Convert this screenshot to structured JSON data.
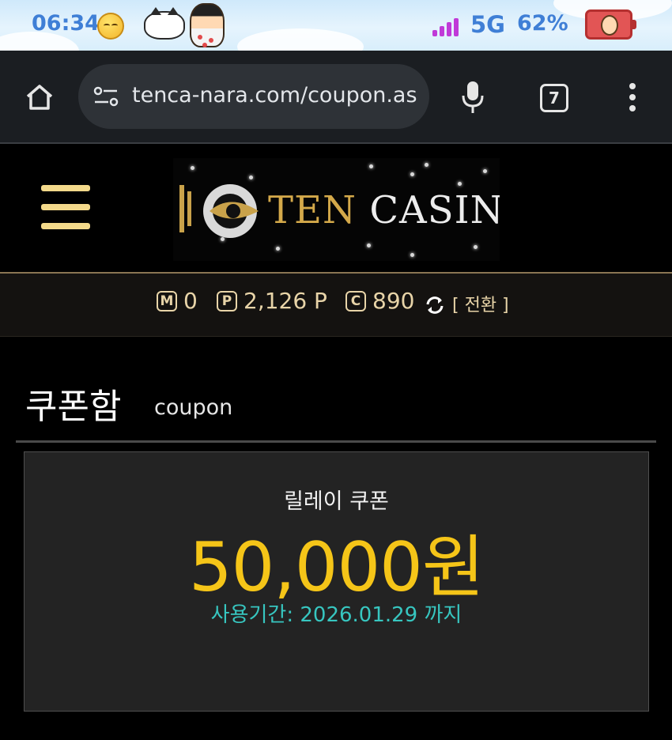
{
  "status_bar": {
    "time": "06:34",
    "network": "5G",
    "battery": "62%"
  },
  "browser": {
    "url": "tenca-nara.com/coupon.as",
    "tab_count": "7"
  },
  "site": {
    "logo_word_1": "TEN",
    "logo_word_2": "CASINO"
  },
  "balances": {
    "m_badge": "M",
    "m_value": "0",
    "p_badge": "P",
    "p_value": "2,126 P",
    "c_badge": "C",
    "c_value": "890",
    "convert_label": "[ 전환 ]"
  },
  "page": {
    "title": "쿠폰함",
    "subtitle": "coupon"
  },
  "coupon": {
    "name": "릴레이 쿠폰",
    "amount": "50,000원",
    "expiry": "사용기간: 2026.01.29 까지"
  },
  "colors": {
    "accent_gold": "#f5c518",
    "expiry_teal": "#37c6c0",
    "menu_gold": "#f3d98a"
  }
}
